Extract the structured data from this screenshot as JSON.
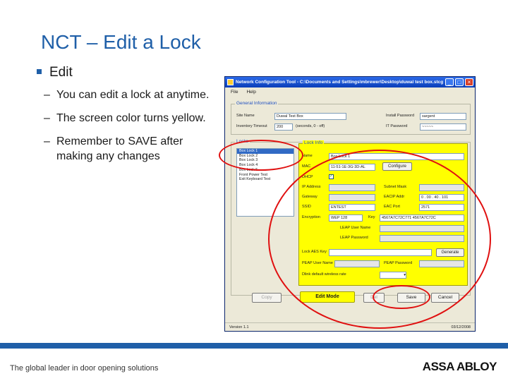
{
  "slide": {
    "title": "NCT – Edit a Lock",
    "bullet": "Edit",
    "subbullets": [
      "You can edit a lock at anytime.",
      "The screen color turns yellow.",
      "Remember to SAVE after making any changes"
    ],
    "footer_tagline": "The global leader in door opening solutions",
    "footer_logo": "ASSA ABLOY"
  },
  "app": {
    "window_title": "Network Configuration Tool - C:\\Documents and Settings\\mbrewer\\Desktop\\duwal test box.stcg",
    "menu": [
      "File",
      "Help"
    ],
    "general": {
      "title": "General Information",
      "site_name_label": "Site Name",
      "site_name_value": "Duwal Test Box",
      "inventory_label": "Inventory Timeout",
      "inventory_value": "200",
      "inventory_unit": "(seconds, 0 - off)",
      "install_pw_label": "Install Password",
      "install_pw_value": "sargent",
      "it_pw_label": "IT Password",
      "it_pw_value": "~~~~~"
    },
    "locks": {
      "title": "Locks",
      "items": [
        "Box Lock 1",
        "Box Lock 2",
        "Box Lock 3",
        "Box Lock 4",
        "Box Lock 5",
        "Front Power Test",
        "Exit Keyboard Test"
      ]
    },
    "lock_info": {
      "title": "Lock Info",
      "name_label": "Name",
      "name_value": "Box Lock 1",
      "mac_label": "MAC",
      "mac_value": "11-51-1E-3G-3D-AL",
      "configure_label": "Configure",
      "dhcp_label": "DHCP",
      "ip_label": "IP Address",
      "subnet_label": "Subnet Mask",
      "gateway_label": "Gateway",
      "dhcp_ip_label": "EACIP Addr",
      "eac_ip_value": "0 . 00 . 40 . 101",
      "ssid_label": "SSID",
      "ssid_value": "ENTEST",
      "eac_port_label": "EAC Port",
      "eac_port_value": "2571",
      "encryption_label": "Encryption",
      "encryption_value": "WEP 128",
      "key_label": "Key",
      "key_value": "4567A7C72C771 4567A7C72C",
      "leap_user_label": "LEAP User Name",
      "leap_pw_label": "LEAP Password",
      "aes_label": "Lock AES Key",
      "generate_label": "Generate",
      "peap_user_label": "PEAP User Name",
      "peap_pw_label": "PEAP Password",
      "default_rate_label": "Dlink default wireless rate"
    },
    "buttons": {
      "copy": "Copy",
      "edit_mode": "Edit Mode",
      "delete": "Del",
      "save": "Save",
      "cancel": "Cancel"
    },
    "status": {
      "version": "Version 1.1",
      "date": "03/12/2008"
    }
  }
}
